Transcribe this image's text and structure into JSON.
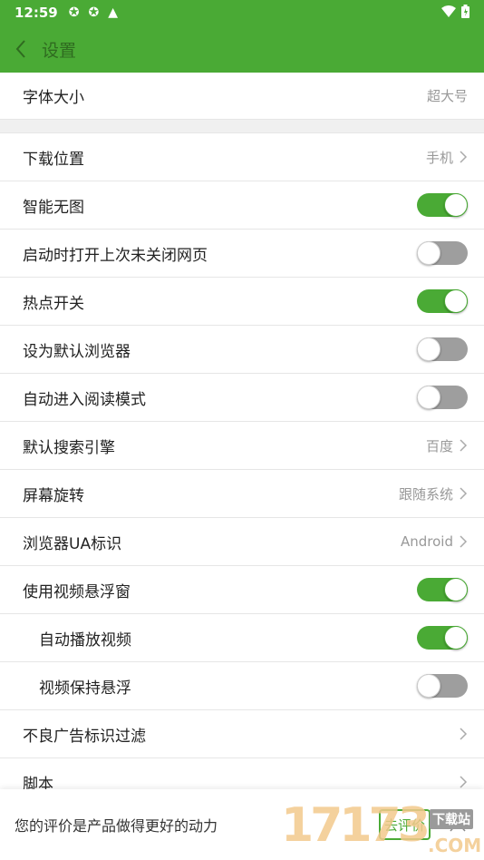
{
  "status_bar": {
    "time": "12:59",
    "icons": [
      "sync-icon",
      "sync-icon",
      "a-icon",
      "wifi-icon",
      "battery-icon"
    ]
  },
  "app_bar": {
    "title": "设置"
  },
  "settings": {
    "font_size": {
      "label": "字体大小",
      "value": "超大号"
    },
    "download_location": {
      "label": "下载位置",
      "value": "手机"
    },
    "smart_no_image": {
      "label": "智能无图",
      "on": true
    },
    "restore_pages": {
      "label": "启动时打开上次未关闭网页",
      "on": false
    },
    "hotspot": {
      "label": "热点开关",
      "on": true
    },
    "default_browser": {
      "label": "设为默认浏览器",
      "on": false
    },
    "auto_reading_mode": {
      "label": "自动进入阅读模式",
      "on": false
    },
    "search_engine": {
      "label": "默认搜索引擎",
      "value": "百度"
    },
    "screen_rotation": {
      "label": "屏幕旋转",
      "value": "跟随系统"
    },
    "user_agent": {
      "label": "浏览器UA标识",
      "value": "Android"
    },
    "floating_video": {
      "label": "使用视频悬浮窗",
      "on": true
    },
    "autoplay_video": {
      "label": "自动播放视频",
      "on": true
    },
    "keep_floating": {
      "label": "视频保持悬浮",
      "on": false
    },
    "ad_filter": {
      "label": "不良广告标识过滤"
    },
    "scripts": {
      "label": "脚本"
    }
  },
  "footer": {
    "message": "您的评价是产品做得更好的动力",
    "rate_button": "去评价"
  },
  "watermark": {
    "digits": "17173",
    "site": "下载站",
    "suffix": ".COM"
  },
  "colors": {
    "accent": "#4aaa35",
    "toggle_off": "#9e9e9e"
  }
}
